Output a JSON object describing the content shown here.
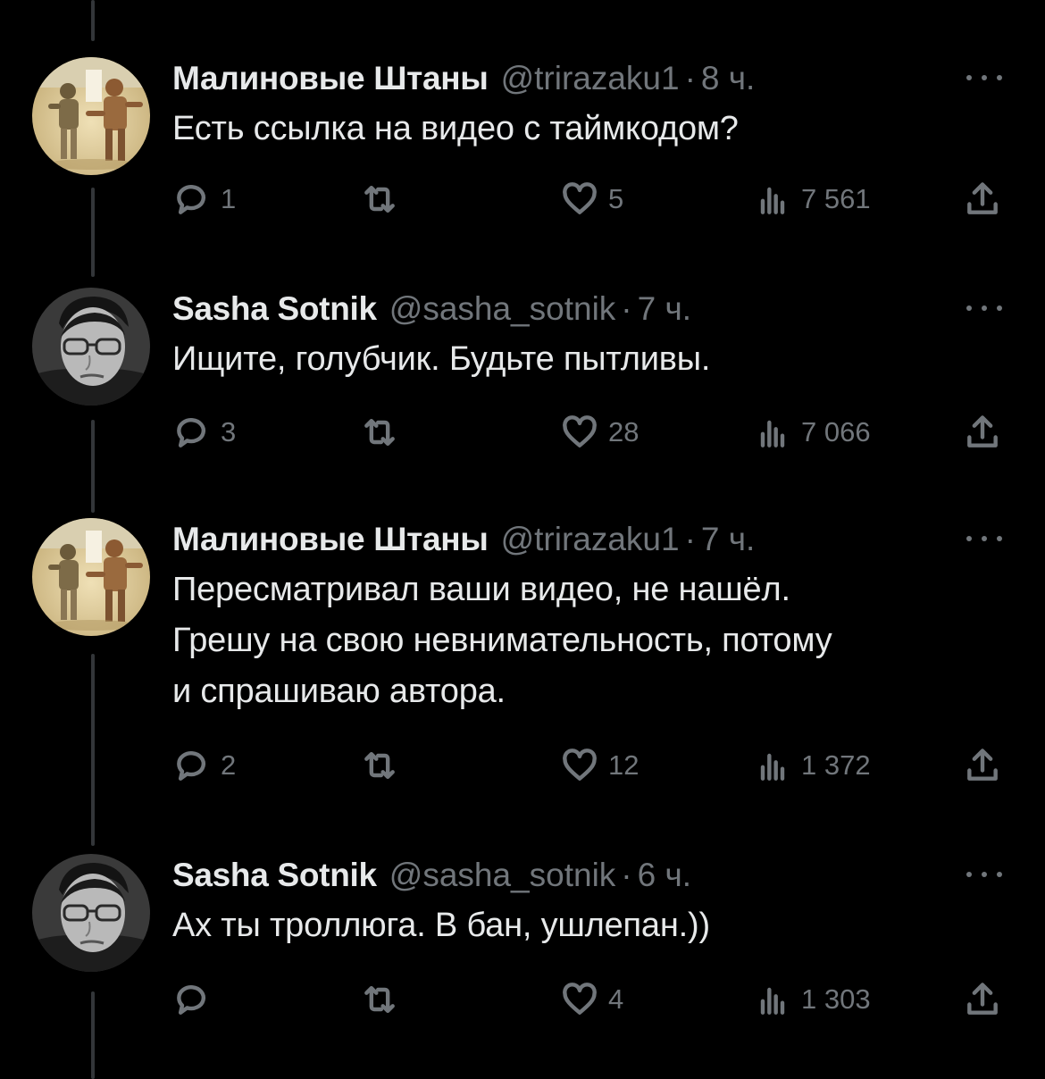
{
  "tweets": [
    {
      "name": "Малиновые Штаны",
      "handle": "@trirazaku1",
      "time": "8 ч.",
      "text": "Есть ссылка на видео с таймкодом?",
      "replies": "1",
      "likes": "5",
      "views": "7 561",
      "avatar": "painting-two-figures"
    },
    {
      "name": "Sasha Sotnik",
      "handle": "@sasha_sotnik",
      "time": "7 ч.",
      "text": "Ищите, голубчик. Будьте пытливы.",
      "replies": "3",
      "likes": "28",
      "views": "7 066",
      "avatar": "grayscale-portrait"
    },
    {
      "name": "Малиновые Штаны",
      "handle": "@trirazaku1",
      "time": "7 ч.",
      "text": "Пересматривал ваши видео, не нашёл.\nГрешу на свою невнимательность,  потому\nи спрашиваю автора.",
      "replies": "2",
      "likes": "12",
      "views": "1 372",
      "avatar": "painting-two-figures"
    },
    {
      "name": "Sasha Sotnik",
      "handle": "@sasha_sotnik",
      "time": "6 ч.",
      "text": "Ах ты троллюга. В бан, ушлепан.))",
      "replies": "",
      "likes": "4",
      "views": "1 303",
      "avatar": "grayscale-portrait"
    }
  ],
  "separator": "·",
  "icons": [
    "reply-icon",
    "retweet-icon",
    "like-icon",
    "views-icon",
    "share-icon",
    "more-icon"
  ],
  "colors": {
    "background": "#000000",
    "text": "#e7e9ea",
    "muted": "#71767b",
    "thread_line": "#333639"
  }
}
